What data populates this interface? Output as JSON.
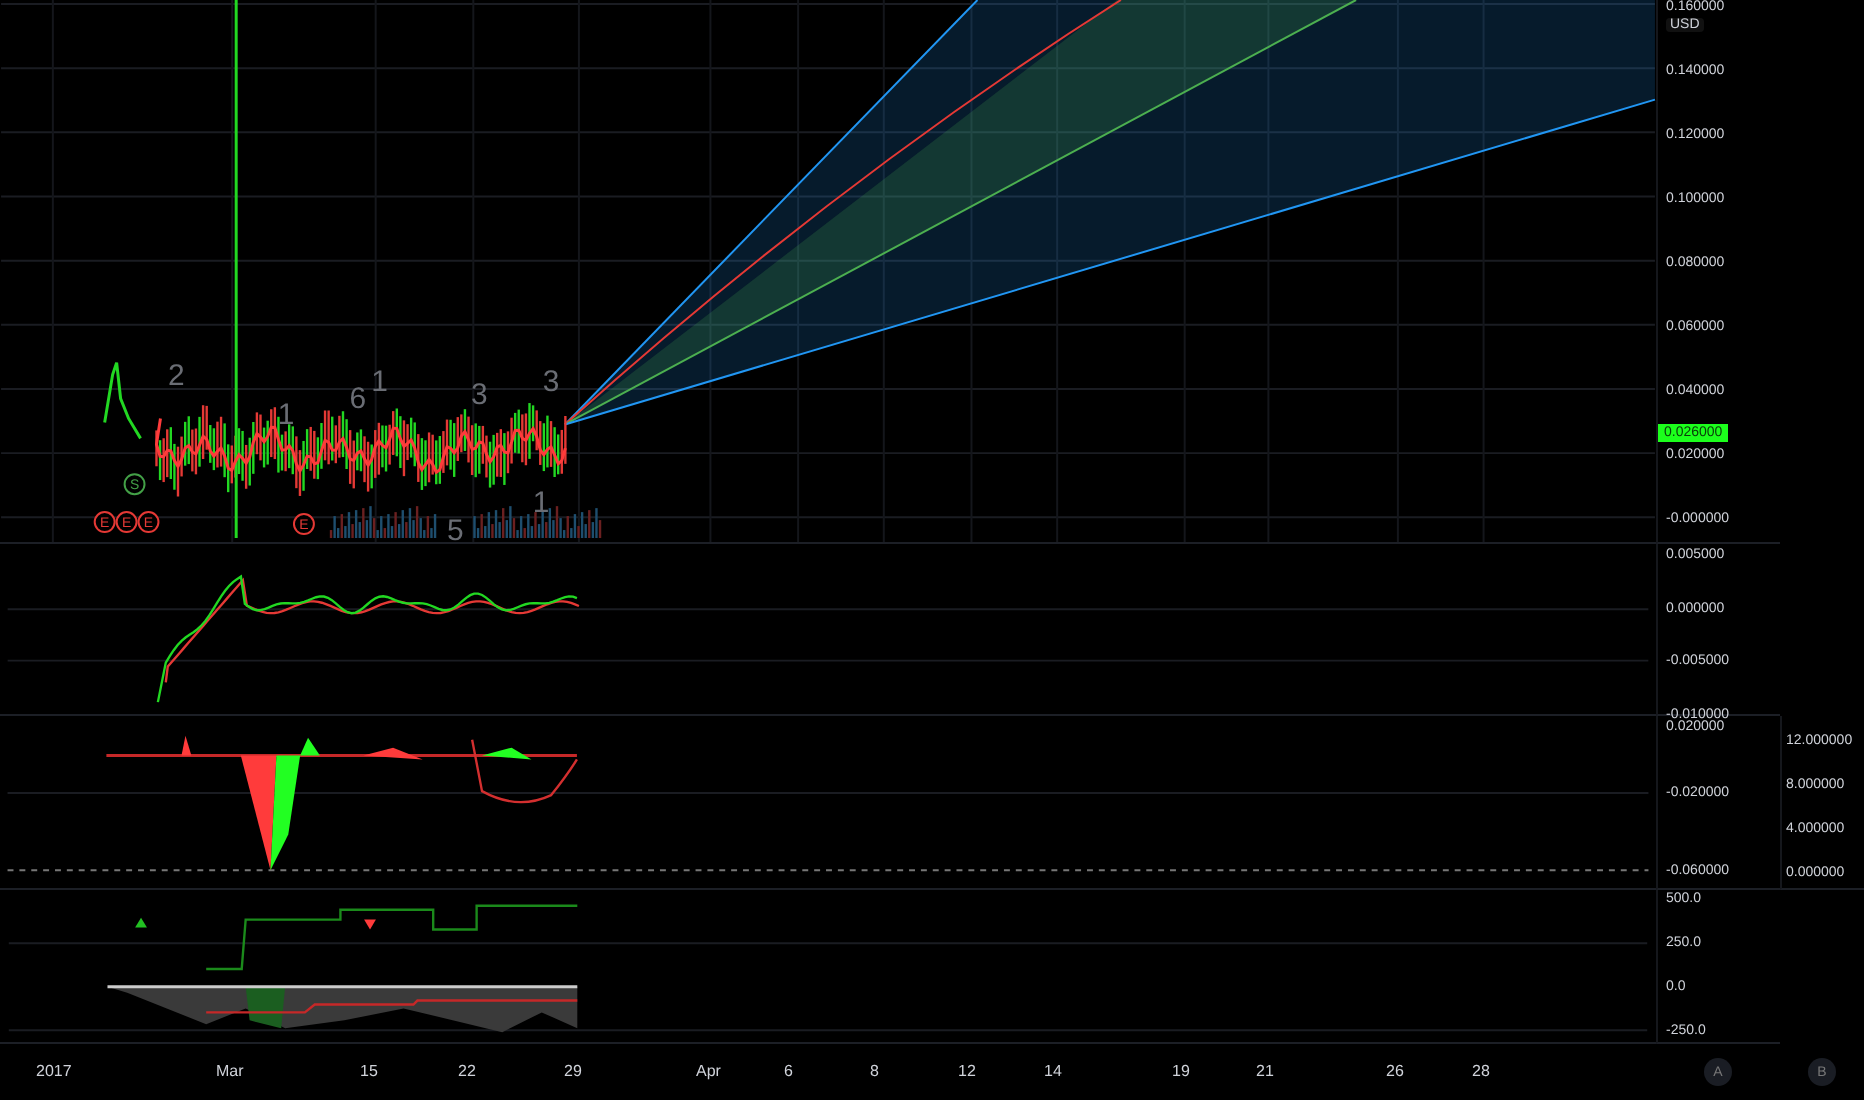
{
  "price_axis": {
    "currency": "USD",
    "last_price": "0.026000",
    "ticks": [
      "0.160000",
      "0.140000",
      "0.120000",
      "0.100000",
      "0.080000",
      "0.060000",
      "0.040000",
      "0.020000",
      "-0.000000"
    ]
  },
  "chart_labels": {
    "wave_counts": [
      "2",
      "1",
      "6",
      "1",
      "3",
      "3",
      "5",
      "1"
    ],
    "event_markers": [
      {
        "text": "S",
        "color": "#43a047"
      },
      {
        "text": "E",
        "color": "#e53935"
      },
      {
        "text": "E",
        "color": "#e53935"
      },
      {
        "text": "E",
        "color": "#e53935"
      },
      {
        "text": "E",
        "color": "#e53935"
      }
    ]
  },
  "oscillator_axis": {
    "ticks": [
      "0.005000",
      "0.000000",
      "-0.005000",
      "-0.010000"
    ]
  },
  "histogram_axis": {
    "ticks": [
      "0.020000",
      "-0.020000",
      "-0.060000"
    ]
  },
  "histogram_axis_b": {
    "ticks": [
      "12.000000",
      "8.000000",
      "4.000000",
      "0.000000"
    ]
  },
  "volume_axis": {
    "ticks": [
      "500.0",
      "250.0",
      "0.0",
      "-250.0"
    ]
  },
  "time_axis": {
    "labels": [
      "2017",
      "Mar",
      "15",
      "22",
      "29",
      "Apr",
      "6",
      "8",
      "12",
      "14",
      "19",
      "21",
      "26",
      "28"
    ]
  },
  "scale_buttons": [
    "A",
    "B"
  ]
}
